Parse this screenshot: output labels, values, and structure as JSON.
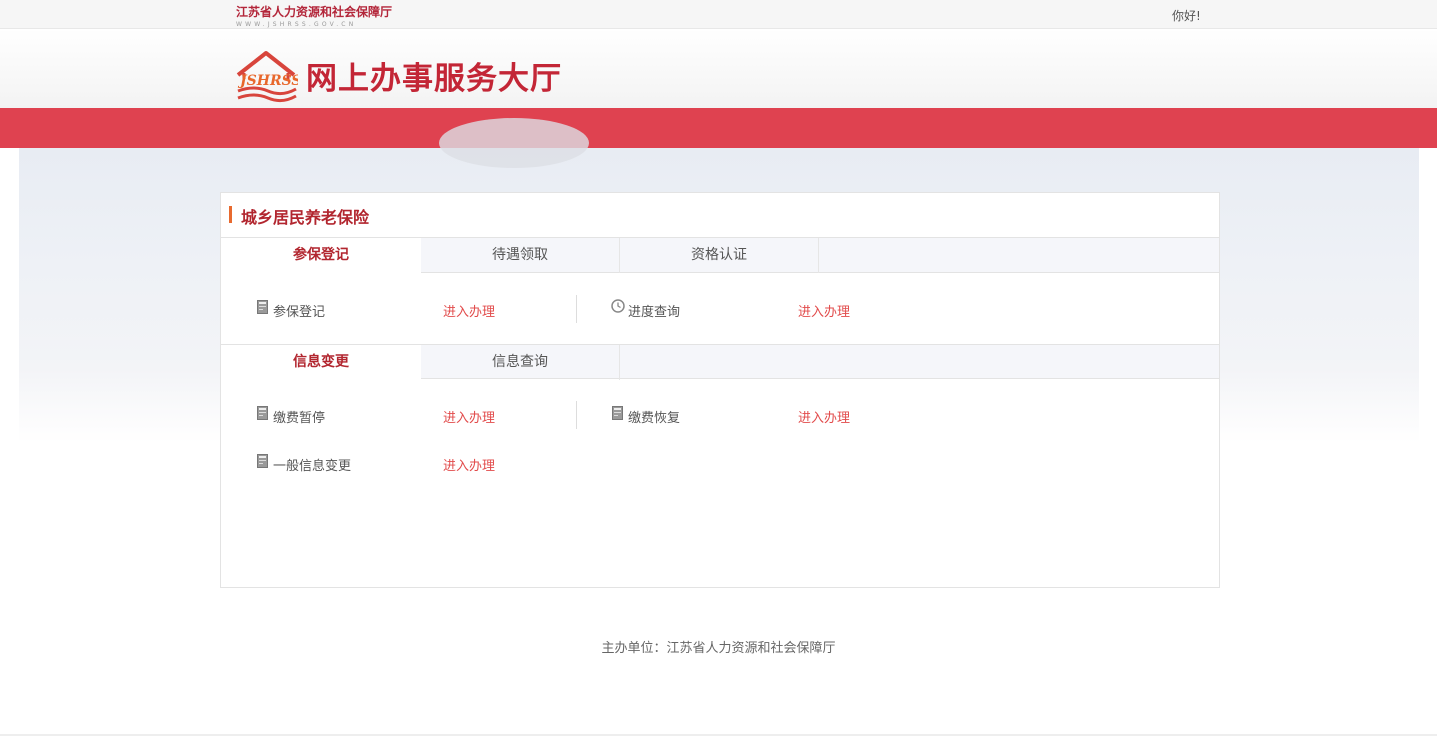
{
  "topbar": {
    "logo_cn": "江苏省人力资源和社会保障厅",
    "logo_en": "WWW.JSHRSS.GOV.CN",
    "greeting": "你好!"
  },
  "header": {
    "logo_text": "JSHRSS",
    "site_title": "网上办事服务大厅"
  },
  "panel": {
    "title": "城乡居民养老保险",
    "section1": {
      "tabs": [
        "参保登记",
        "待遇领取",
        "资格认证"
      ],
      "items": [
        {
          "label": "参保登记",
          "link": "进入办理"
        },
        {
          "label": "进度查询",
          "link": "进入办理"
        }
      ]
    },
    "section2": {
      "tabs": [
        "信息变更",
        "信息查询"
      ],
      "items": [
        {
          "label": "缴费暂停",
          "link": "进入办理"
        },
        {
          "label": "缴费恢复",
          "link": "进入办理"
        },
        {
          "label": "一般信息变更",
          "link": "进入办理"
        }
      ]
    }
  },
  "footer": {
    "text": "主办单位：江苏省人力资源和社会保障厅"
  },
  "colors": {
    "brand_red": "#df4250",
    "title_red": "#b2262f",
    "link_red": "#e24b4b",
    "accent_orange": "#e86a2f"
  }
}
